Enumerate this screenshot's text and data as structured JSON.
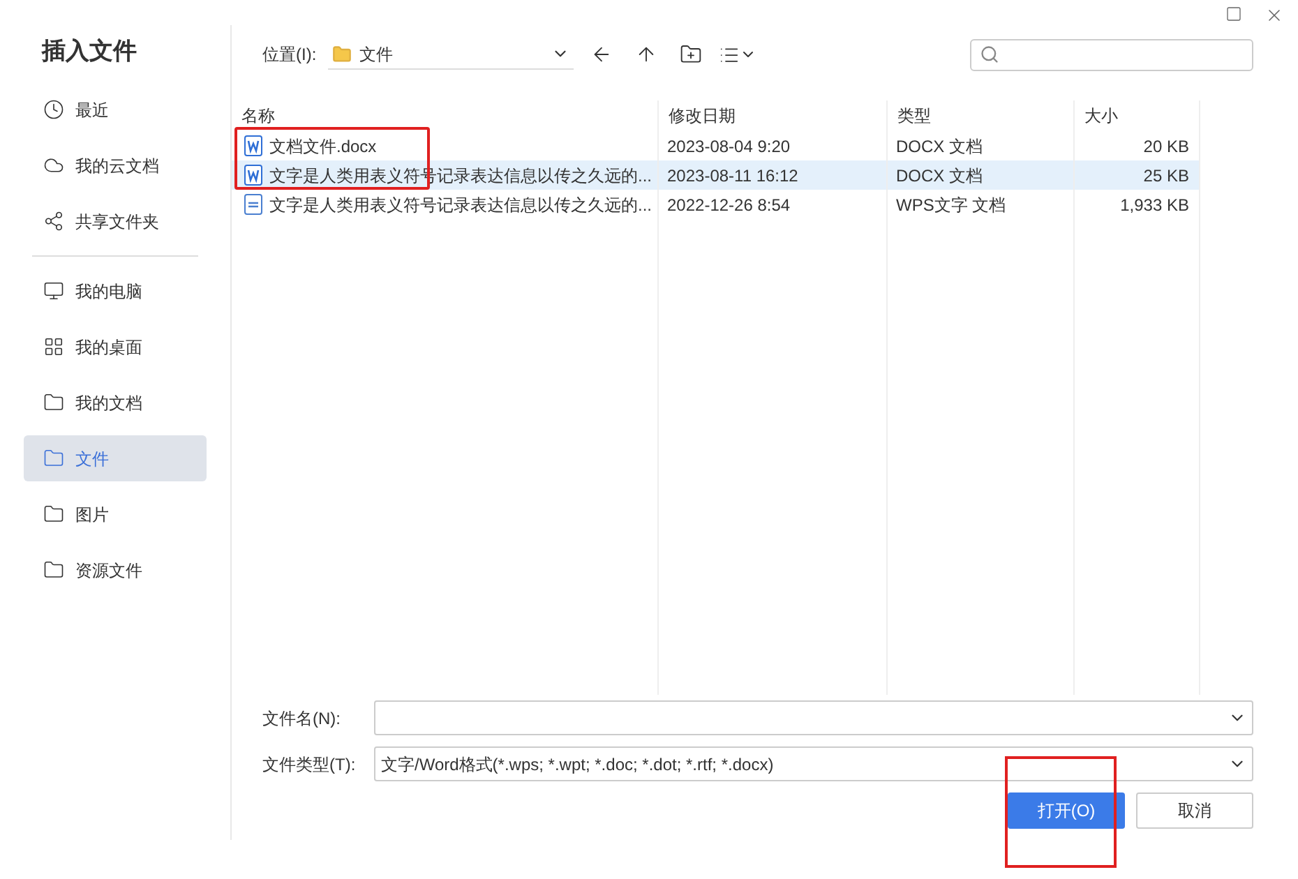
{
  "window": {
    "title": "插入文件"
  },
  "sidebar": {
    "items": [
      {
        "label": "最近",
        "selected": false
      },
      {
        "label": "我的云文档",
        "selected": false
      },
      {
        "label": "共享文件夹",
        "selected": false
      },
      {
        "label": "我的电脑",
        "selected": false
      },
      {
        "label": "我的桌面",
        "selected": false
      },
      {
        "label": "我的文档",
        "selected": false
      },
      {
        "label": "文件",
        "selected": true
      },
      {
        "label": "图片",
        "selected": false
      },
      {
        "label": "资源文件",
        "selected": false
      }
    ]
  },
  "toolbar": {
    "location_label": "位置(I):",
    "location_value": "文件"
  },
  "table": {
    "columns": [
      "名称",
      "修改日期",
      "类型",
      "大小"
    ],
    "rows": [
      {
        "name": "文档文件.docx",
        "date": "2023-08-04 9:20",
        "type": "DOCX 文档",
        "size": "20 KB",
        "kind": "docx",
        "selected": false
      },
      {
        "name": "文字是人类用表义符号记录表达信息以传之久远的...",
        "date": "2023-08-11 16:12",
        "type": "DOCX 文档",
        "size": "25 KB",
        "kind": "docx",
        "selected": true
      },
      {
        "name": "文字是人类用表义符号记录表达信息以传之久远的...",
        "date": "2022-12-26 8:54",
        "type": "WPS文字 文档",
        "size": "1,933 KB",
        "kind": "wps",
        "selected": false
      }
    ]
  },
  "form": {
    "filename_label": "文件名(N):",
    "filetype_label": "文件类型(T):",
    "filetype_value": "文字/Word格式(*.wps; *.wpt; *.doc; *.dot; *.rtf; *.docx)"
  },
  "buttons": [
    "打开(O)",
    "取消"
  ]
}
